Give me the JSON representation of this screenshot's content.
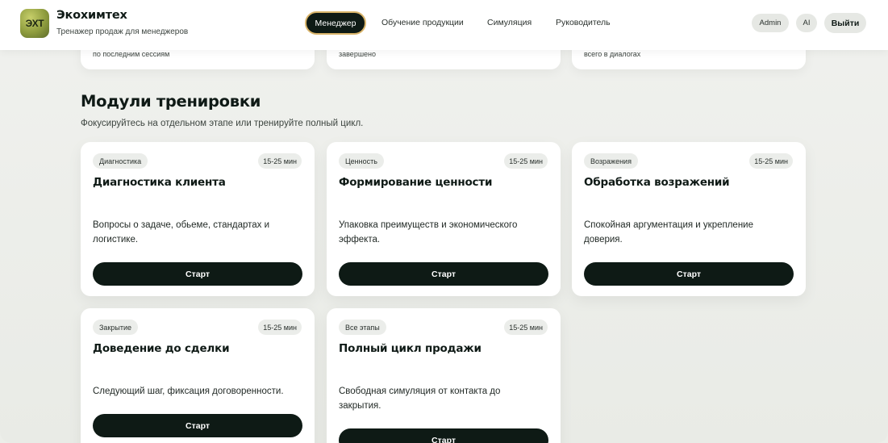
{
  "brand": {
    "logo_text": "ЭХТ",
    "title": "Экохимтех",
    "subtitle": "Тренажер продаж для менеджеров"
  },
  "nav": {
    "manager": "Менеджер",
    "training": "Обучение продукции",
    "simulation": "Симуляция",
    "lead": "Руководитель"
  },
  "user": {
    "admin": "Admin",
    "ai": "AI",
    "logout": "Выйти"
  },
  "stats": [
    {
      "caption": "по последним сессиям"
    },
    {
      "caption": "завершено"
    },
    {
      "caption": "всего в диалогах"
    }
  ],
  "section": {
    "title": "Модули тренировки",
    "subtitle": "Фокусируйтесь на отдельном этапе или тренируйте полный цикл."
  },
  "modules": [
    {
      "tag": "Диагностика",
      "duration": "15-25 мин",
      "title": "Диагностика клиента",
      "desc": "Вопросы о задаче, обьеме, стандартах и логистике.",
      "button": "Старт"
    },
    {
      "tag": "Ценность",
      "duration": "15-25 мин",
      "title": "Формирование ценности",
      "desc": "Упаковка преимуществ и экономического эффекта.",
      "button": "Старт"
    },
    {
      "tag": "Возражения",
      "duration": "15-25 мин",
      "title": "Обработка возражений",
      "desc": "Спокойная аргументация и укрепление доверия.",
      "button": "Старт"
    },
    {
      "tag": "Закрытие",
      "duration": "15-25 мин",
      "title": "Доведение до сделки",
      "desc": "Следующий шаг, фиксация договоренности.",
      "button": "Старт"
    },
    {
      "tag": "Все этапы",
      "duration": "15-25 мин",
      "title": "Полный цикл продажи",
      "desc": "Свободная симуляция от контакта до закрытия.",
      "button": "Старт"
    }
  ]
}
